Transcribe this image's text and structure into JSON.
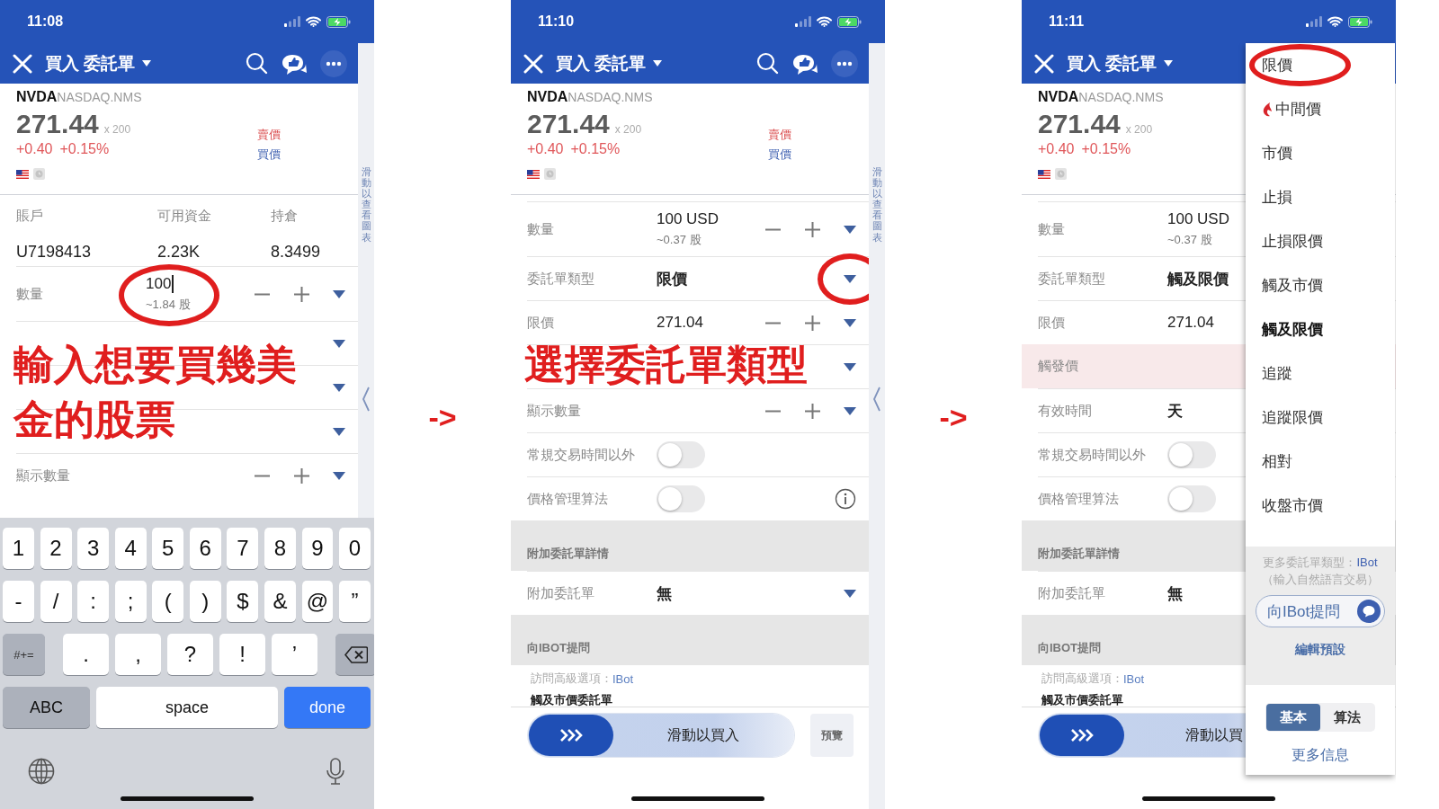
{
  "phones": [
    {
      "status": {
        "time": "11:08"
      },
      "nav": {
        "title": "買入 委託單",
        "actions": true
      },
      "quote": {
        "symbol": "NVDA",
        "exchange": "NASDAQ.NMS",
        "price": "271.44",
        "size": "x 200",
        "change": "+0.40",
        "change_pct": "+0.15%",
        "ask_label": "賣價",
        "bid_label": "買價"
      },
      "side_panel": {
        "label": "滑動以查看圖表"
      },
      "account": [
        {
          "label": "賬戶",
          "value": "U7198413"
        },
        {
          "label": "可用資金",
          "value": "2.23K"
        },
        {
          "label": "持倉",
          "value": "8.3499"
        }
      ],
      "rows": [
        {
          "kind": "quantity",
          "label": "數量",
          "value": "100",
          "sub": "~1.84 股",
          "stepper": true,
          "dropdown": true,
          "circled": true,
          "editing": true
        },
        {
          "kind": "select",
          "stepper": false,
          "dropdown": true,
          "circled": false
        },
        {
          "kind": "price",
          "stepper": false,
          "dropdown": true,
          "circled": false
        },
        {
          "kind": "select",
          "stepper": false,
          "dropdown": true,
          "circled": false
        },
        {
          "kind": "price",
          "label": "顯示數量",
          "stepper": true,
          "dropdown": true,
          "circled": false
        }
      ],
      "annotation": "輸入想要買幾美金的股票",
      "keyboard": {
        "digit_keys": [
          "1",
          "2",
          "3",
          "4",
          "5",
          "6",
          "7",
          "8",
          "9",
          "0"
        ],
        "symbol_keys": [
          "-",
          "/",
          ":",
          ";",
          "(",
          ")",
          "$",
          "&",
          "@",
          "”"
        ],
        "punctuation_keys": [
          ".",
          ",",
          "?",
          "!",
          "’"
        ],
        "mode_key": "#+=",
        "abc_key": "ABC",
        "space_key": "space",
        "done_key": "done"
      }
    },
    {
      "status": {
        "time": "11:10"
      },
      "nav": {
        "title": "買入 委託單",
        "actions": true
      },
      "quote": {
        "symbol": "NVDA",
        "exchange": "NASDAQ.NMS",
        "price": "271.44",
        "size": "x 200",
        "change": "+0.40",
        "change_pct": "+0.15%",
        "ask_label": "賣價",
        "bid_label": "買價"
      },
      "side_panel": {
        "label": "滑動以查看圖表"
      },
      "rows": [
        {
          "kind": "quantity",
          "label": "數量",
          "value": "100 USD",
          "sub": "~0.37 股",
          "stepper": true,
          "dropdown": true,
          "circled": false,
          "editing": false
        },
        {
          "kind": "select",
          "label": "委託單類型",
          "value": "限價",
          "stepper": false,
          "dropdown": true,
          "circled": true
        },
        {
          "kind": "price",
          "label": "限價",
          "value": "271.04",
          "stepper": true,
          "dropdown": true,
          "circled": false
        },
        {
          "kind": "select",
          "stepper": false,
          "dropdown": true,
          "circled": false
        },
        {
          "kind": "price",
          "label": "顯示數量",
          "stepper": true,
          "dropdown": true,
          "circled": false
        },
        {
          "kind": "toggle",
          "label": "常規交易時間以外",
          "on": false,
          "info": false
        },
        {
          "kind": "toggle",
          "label": "價格管理算法",
          "on": false,
          "info": true
        },
        {
          "kind": "section",
          "label": "附加委託單詳情"
        },
        {
          "kind": "select",
          "label": "附加委託單",
          "value": "無",
          "stepper": false,
          "dropdown": true,
          "circled": false
        },
        {
          "kind": "section",
          "label": "向IBOT提問"
        },
        {
          "kind": "link",
          "prefix": "訪問高級選項：",
          "link": "IBot"
        },
        {
          "kind": "note",
          "label": "觸及市價委託單"
        }
      ],
      "annotation": "選擇委託單類型",
      "bottom": {
        "slider": "滑動以買入",
        "level": 0,
        "preview": "預覽"
      }
    },
    {
      "status": {
        "time": "11:11"
      },
      "nav": {
        "title": "買入 委託單"
      },
      "quote": {
        "symbol": "NVDA",
        "exchange": "NASDAQ.NMS",
        "price": "271.44",
        "size": "x 200",
        "change": "+0.40",
        "change_pct": "+0.15%"
      },
      "rows": [
        {
          "kind": "quantity",
          "label": "數量",
          "value": "100 USD",
          "sub": "~0.37 股",
          "editing": false
        },
        {
          "kind": "select",
          "label": "委託單類型",
          "value": "觸及限價"
        },
        {
          "kind": "price",
          "label": "限價",
          "value": "271.04"
        },
        {
          "kind": "trigger",
          "label": "觸發價"
        },
        {
          "kind": "select",
          "label": "有效時間",
          "value": "天"
        },
        {
          "kind": "toggle",
          "label": "常規交易時間以外",
          "on": false
        },
        {
          "kind": "toggle",
          "label": "價格管理算法",
          "on": false
        },
        {
          "kind": "section",
          "label": "附加委託單詳情"
        },
        {
          "kind": "select",
          "label": "附加委託單",
          "value": "無"
        },
        {
          "kind": "section",
          "label": "向IBOT提問"
        },
        {
          "kind": "link",
          "prefix": "訪問高級選項：",
          "link": "IBot"
        },
        {
          "kind": "note",
          "label": "觸及市價委託單"
        }
      ],
      "bottom": {
        "slider": "滑動以買",
        "level": 0
      },
      "menu": {
        "items": [
          {
            "label": "限價",
            "kind": "plain",
            "selected": false,
            "circled": true
          },
          {
            "label": "中間價",
            "kind": "featured",
            "selected": false,
            "circled": false
          },
          {
            "label": "市價",
            "kind": "plain",
            "selected": false,
            "circled": false
          },
          {
            "label": "止損",
            "kind": "plain",
            "selected": false,
            "circled": false
          },
          {
            "label": "止損限價",
            "kind": "plain",
            "selected": false,
            "circled": false
          },
          {
            "label": "觸及市價",
            "kind": "plain",
            "selected": false,
            "circled": false
          },
          {
            "label": "觸及限價",
            "kind": "plain",
            "selected": true,
            "circled": false
          },
          {
            "label": "追蹤",
            "kind": "plain",
            "selected": false,
            "circled": false
          },
          {
            "label": "追蹤限價",
            "kind": "plain",
            "selected": false,
            "circled": false
          },
          {
            "label": "相對",
            "kind": "plain",
            "selected": false,
            "circled": false
          },
          {
            "label": "收盤市價",
            "kind": "plain",
            "selected": false,
            "circled": false
          }
        ],
        "hint": {
          "prefix": "更多委託單類型：",
          "link": "IBot",
          "note": "（輸入自然語言交易）"
        },
        "ask_button": "向IBot提問",
        "edit_link": "編輯預設",
        "segments": [
          {
            "label": "基本",
            "selected": true
          },
          {
            "label": "算法",
            "selected": false
          }
        ],
        "more_link": "更多信息"
      }
    }
  ],
  "arrows": [
    "->",
    "->"
  ]
}
